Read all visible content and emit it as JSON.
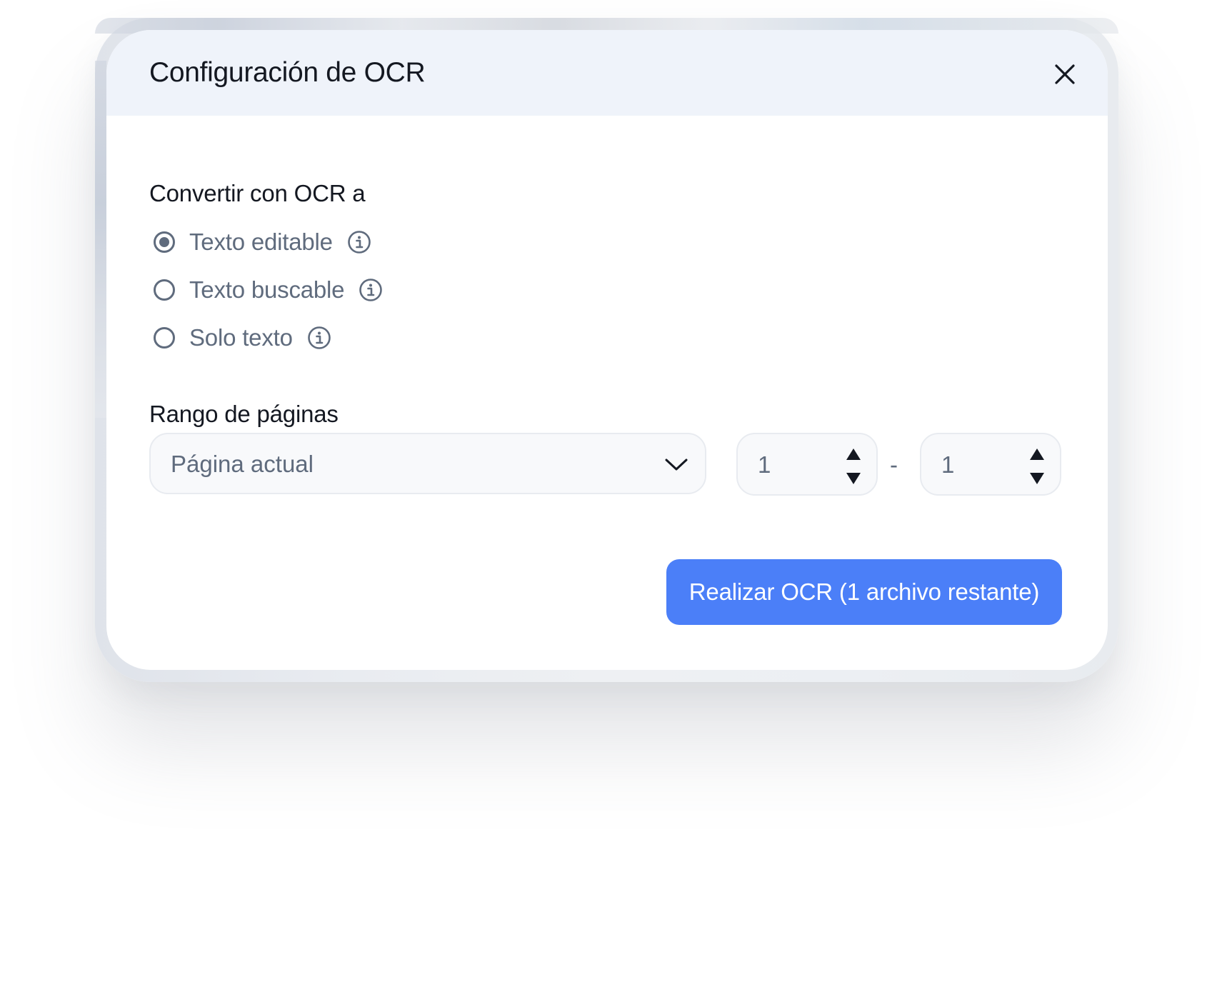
{
  "dialog": {
    "title": "Configuración de OCR",
    "close_icon": "close-icon"
  },
  "convert": {
    "label": "Convertir con OCR a",
    "options": [
      {
        "label": "Texto editable",
        "checked": true,
        "icon": "info-icon"
      },
      {
        "label": "Texto buscable",
        "checked": false,
        "icon": "info-icon"
      },
      {
        "label": "Solo texto",
        "checked": false,
        "icon": "info-icon"
      }
    ]
  },
  "range": {
    "label": "Rango de páginas",
    "select_value": "Página actual",
    "select_icon": "chevron-down-icon",
    "from": "1",
    "to": "1",
    "separator": "-",
    "stepper_icons": [
      "triangle-up-icon",
      "triangle-down-icon"
    ]
  },
  "action": {
    "button_label": "Realizar OCR (1 archivo restante)"
  },
  "colors": {
    "accent": "#4b7ff8",
    "header_bg": "#eff3fa",
    "text_primary": "#141821",
    "text_secondary": "#5f6b7d"
  }
}
